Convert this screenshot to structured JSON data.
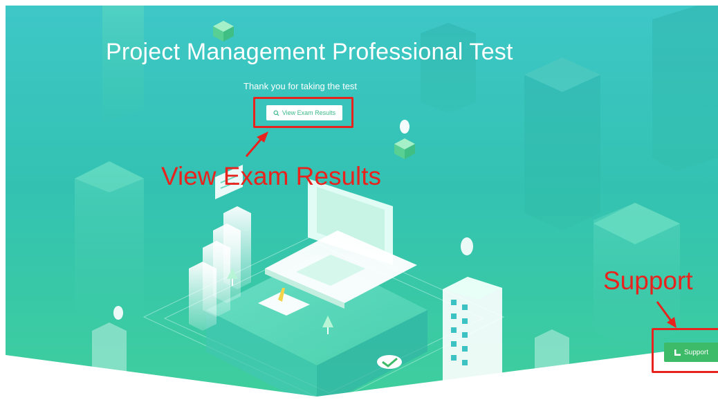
{
  "page": {
    "title": "Project Management Professional Test",
    "subtitle": "Thank you for taking the test"
  },
  "actions": {
    "view_results_label": "View Exam Results",
    "support_label": "Support"
  },
  "annotations": {
    "results_label": "View Exam Results",
    "support_label": "Support"
  },
  "icons": {
    "view_results": "search-icon",
    "support": "support-icon"
  },
  "colors": {
    "background_top": "#3ec7c7",
    "background_bottom": "#3fcf9b",
    "annotation_red": "#e8231d",
    "support_green": "#3dbb68",
    "button_text_green": "#3bb88b"
  }
}
